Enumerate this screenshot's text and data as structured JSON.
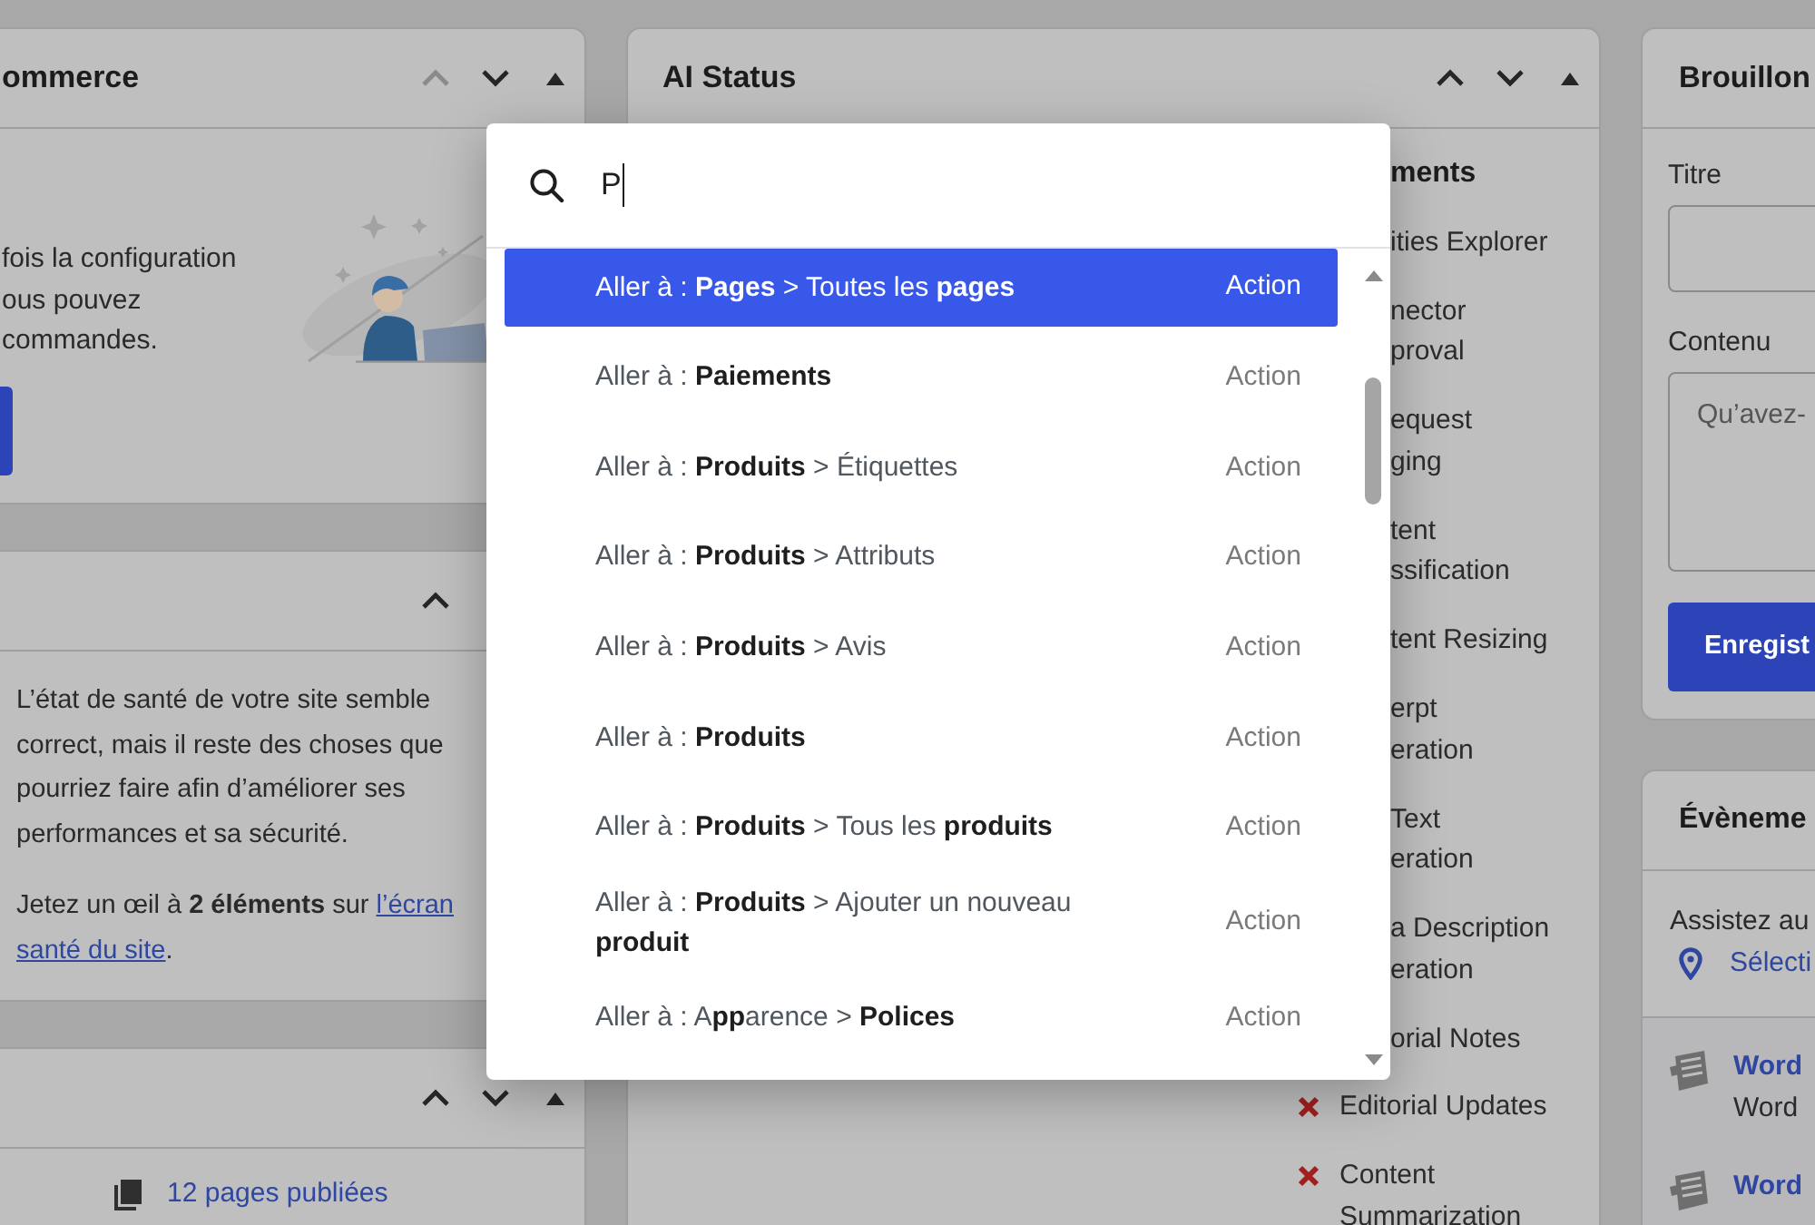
{
  "columns": [
    {
      "cards": [
        {
          "kind": "setup",
          "title": "ommerce",
          "controls": [
            {
              "kind": "up",
              "disabled": true
            },
            {
              "kind": "down",
              "disabled": false
            },
            {
              "kind": "toggle",
              "expanded": true
            }
          ],
          "lines": [
            "fois la configuration",
            "ous pouvez",
            "commandes."
          ]
        },
        {
          "kind": "health",
          "controls": [
            {
              "kind": "up",
              "disabled": false
            }
          ],
          "lines": [
            "L’état de santé de votre site semble",
            "correct, mais il reste des choses que",
            "pourriez faire afin d’améliorer ses",
            "performances et sa sécurité."
          ],
          "note": {
            "before": "Jetez un œil à **2 éléments** sur",
            "link_start": "l’écran",
            "link_end": "santé du site",
            "after": "."
          }
        },
        {
          "kind": "glance",
          "controls": [
            {
              "kind": "up",
              "disabled": false
            },
            {
              "kind": "down",
              "disabled": false
            },
            {
              "kind": "toggle",
              "expanded": true
            }
          ],
          "stat": "12 pages publiées"
        }
      ]
    },
    {
      "cards": [
        {
          "kind": "status",
          "title": "AI Status",
          "controls": [
            {
              "kind": "up",
              "disabled": false
            },
            {
              "kind": "down",
              "disabled": false
            },
            {
              "kind": "toggle",
              "expanded": true
            }
          ],
          "heading": "ments",
          "items": [
            {
              "kind": "covered",
              "lines": [
                "ities Explorer"
              ]
            },
            {
              "kind": "covered",
              "lines": [
                "nector",
                "proval"
              ]
            },
            {
              "kind": "covered",
              "lines": [
                "equest",
                "ging"
              ]
            },
            {
              "kind": "covered",
              "lines": [
                "tent",
                "ssification"
              ]
            },
            {
              "kind": "covered",
              "lines": [
                "tent Resizing"
              ]
            },
            {
              "kind": "covered",
              "lines": [
                "erpt",
                "eration"
              ]
            },
            {
              "kind": "covered",
              "lines": [
                "Text",
                "eration"
              ]
            },
            {
              "kind": "covered",
              "lines": [
                "a Description",
                "eration"
              ]
            },
            {
              "kind": "covered",
              "lines": [
                "orial Notes"
              ]
            },
            {
              "kind": "failed",
              "lines": [
                "Editorial Updates"
              ]
            },
            {
              "kind": "failed",
              "lines": [
                "Content",
                "Summarization"
              ]
            }
          ]
        }
      ]
    },
    {
      "cards": [
        {
          "kind": "draft",
          "title": "Brouillon",
          "fields": [
            {
              "kind": "input",
              "label": "Titre"
            },
            {
              "kind": "textarea",
              "label": "Contenu",
              "placeholder": "Qu’avez-"
            }
          ],
          "button": "Enregist"
        },
        {
          "kind": "events",
          "title": "Évèneme",
          "intro": "Assistez au",
          "location": "Sélecti",
          "events": [
            {
              "title": "Word",
              "subtitle": "Word"
            },
            {
              "title": "Word"
            }
          ]
        }
      ]
    }
  ],
  "command_palette": {
    "query": "P",
    "results": [
      {
        "label": "Aller à : **Pages** > Toutes les **pages**",
        "type": "Action",
        "selected": true
      },
      {
        "label": "Aller à : **Paiements**",
        "type": "Action",
        "selected": false
      },
      {
        "label": "Aller à : **Produits** > Étiquettes",
        "type": "Action",
        "selected": false
      },
      {
        "label": "Aller à : **Produits** > Attributs",
        "type": "Action",
        "selected": false
      },
      {
        "label": "Aller à : **Produits** > Avis",
        "type": "Action",
        "selected": false
      },
      {
        "label": "Aller à : **Produits**",
        "type": "Action",
        "selected": false
      },
      {
        "label": "Aller à : **Produits** > Tous les **produits**",
        "type": "Action",
        "selected": false
      },
      {
        "label": "Aller à : **Produits** > Ajouter un nouveau **produit**",
        "type": "Action",
        "selected": false
      },
      {
        "label": "Aller à : A**pp**arence > **Polices**",
        "type": "Action",
        "selected": false
      }
    ]
  }
}
